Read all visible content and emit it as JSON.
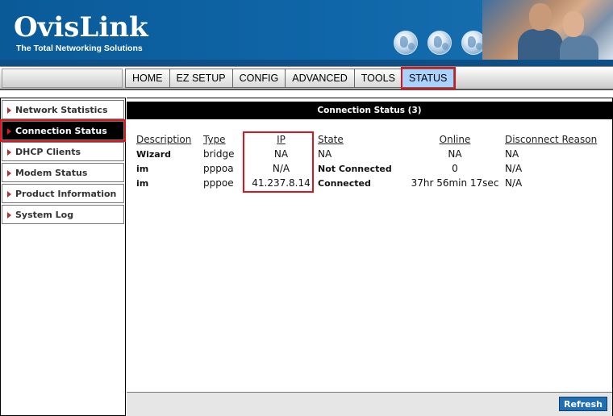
{
  "brand": {
    "logo": "OvisLink",
    "tagline": "The Total Networking Solutions"
  },
  "menu": {
    "items": [
      {
        "label": "HOME"
      },
      {
        "label": "EZ SETUP"
      },
      {
        "label": "CONFIG"
      },
      {
        "label": "ADVANCED"
      },
      {
        "label": "TOOLS"
      },
      {
        "label": "STATUS",
        "active": true
      }
    ]
  },
  "sidebar": {
    "items": [
      {
        "label": "Network Statistics"
      },
      {
        "label": "Connection Status",
        "active": true
      },
      {
        "label": "DHCP Clients"
      },
      {
        "label": "Modem Status"
      },
      {
        "label": "Product Information"
      },
      {
        "label": "System Log"
      }
    ]
  },
  "main": {
    "title": "Connection Status (3)",
    "table": {
      "headers": [
        "Description",
        "Type",
        "IP",
        "State",
        "Online",
        "Disconnect Reason"
      ],
      "rows": [
        [
          "Wizard",
          "bridge",
          "NA",
          "NA",
          "NA",
          "NA"
        ],
        [
          "im",
          "pppoa",
          "N/A",
          "Not Connected",
          "0",
          "N/A"
        ],
        [
          "im",
          "pppoe",
          "41.237.8.14",
          "Connected",
          "37hr 56min 17sec",
          "N/A"
        ]
      ]
    },
    "refresh_label": "Refresh"
  },
  "colors": {
    "banner": "#0d5e9e",
    "highlight": "#e0131d",
    "active_menu": "#aad2ff",
    "refresh_button": "#1f6fb5"
  }
}
